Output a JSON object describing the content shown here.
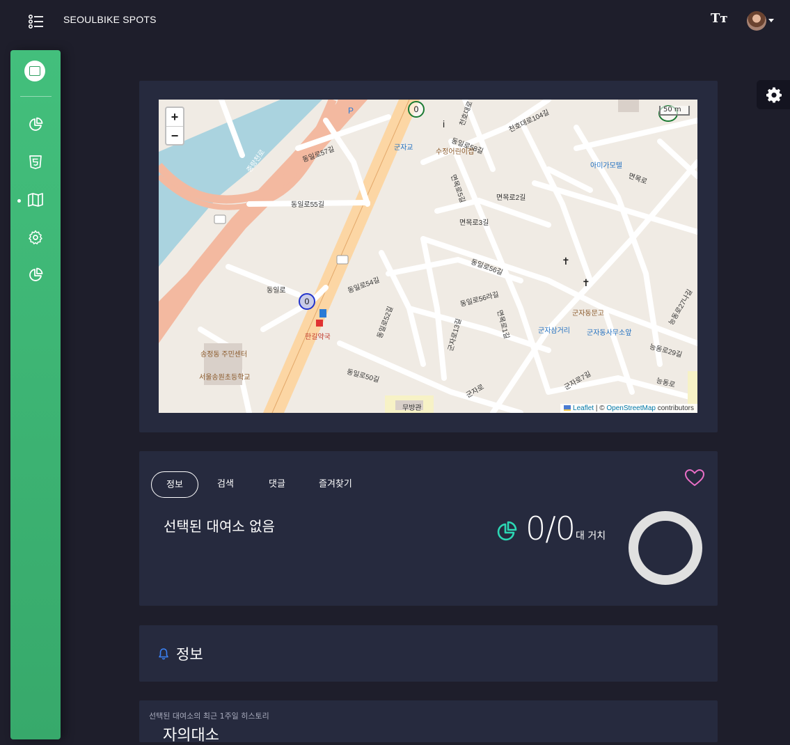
{
  "header": {
    "brand": "SEOULBIKE SPOTS",
    "menu_icon": "list-menu-icon",
    "font_icon": "text-size-icon",
    "font_glyph": "Tт",
    "avatar_icon": "user-avatar"
  },
  "sidebar": {
    "logo_icon": "bike-station-logo",
    "items": [
      {
        "icon": "pie-chart-icon"
      },
      {
        "icon": "html5-icon"
      },
      {
        "icon": "map-icon",
        "active": true
      },
      {
        "icon": "gear-icon"
      },
      {
        "icon": "pie-chart-icon"
      }
    ]
  },
  "settings_tab": {
    "icon": "gear-icon"
  },
  "map": {
    "zoom_in": "+",
    "zoom_out": "−",
    "scale": "50 m",
    "attribution": {
      "leaflet": "Leaflet",
      "separator": " | © ",
      "osm": "OpenStreetMap",
      "suffix": " contributors"
    },
    "markers": [
      {
        "label": "0",
        "color": "#2233cc"
      },
      {
        "label": "0",
        "color": "#1a7a32"
      },
      {
        "label": "",
        "color": "#1a7a32"
      }
    ],
    "road_labels": [
      "동일로55길",
      "동일로57길",
      "동일로58길",
      "동일로",
      "면목로",
      "면목로2길",
      "면목로3길",
      "면목로5길",
      "동일로56길",
      "동일로54길",
      "동일로52길",
      "동일로50길",
      "천호대로104길",
      "천호대로",
      "군자로",
      "군자로13길",
      "면목로1길",
      "동일로56라길",
      "군자로7길",
      "능동로27나길",
      "능동로29길",
      "능동로",
      "중랑천로"
    ],
    "poi_labels": [
      "군자교",
      "수정어린이집",
      "아미가모텔",
      "송정동 주민센터",
      "서울송원초등학교",
      "한길약국",
      "군자동문고",
      "군자삼거리",
      "군자동사무소앞",
      "무방관"
    ]
  },
  "tabs": [
    {
      "label": "정보",
      "active": true
    },
    {
      "label": "검색",
      "active": false
    },
    {
      "label": "댓글",
      "active": false
    },
    {
      "label": "즐겨찾기",
      "active": false
    }
  ],
  "station": {
    "title": "선택된 대여소 없음",
    "count": "0/0",
    "count_unit": "대 거치",
    "occupancy_ratio": 0,
    "accent_color": "#2cd7b4",
    "heart_color": "#ea6fc7"
  },
  "notice": {
    "icon": "bell-icon",
    "title": "정보"
  },
  "history": {
    "subtitle": "선택된 대여소의 최근 1주일 히스토리",
    "title": "자의대소"
  }
}
